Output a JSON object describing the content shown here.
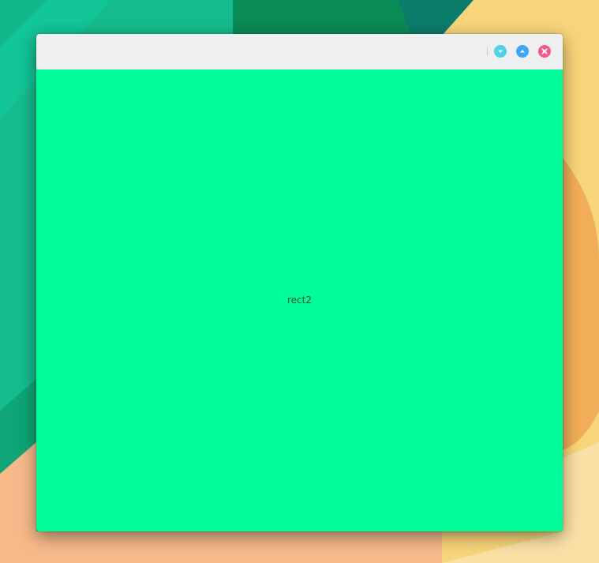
{
  "window": {
    "controls": [
      {
        "icon": "minimize-icon",
        "color": "#4fd2e4"
      },
      {
        "icon": "maximize-icon",
        "color": "#3ea6f3"
      },
      {
        "icon": "close-icon",
        "color": "#f2578f"
      }
    ],
    "background_color": "#00fd9a"
  },
  "content": {
    "label": "rect2"
  }
}
